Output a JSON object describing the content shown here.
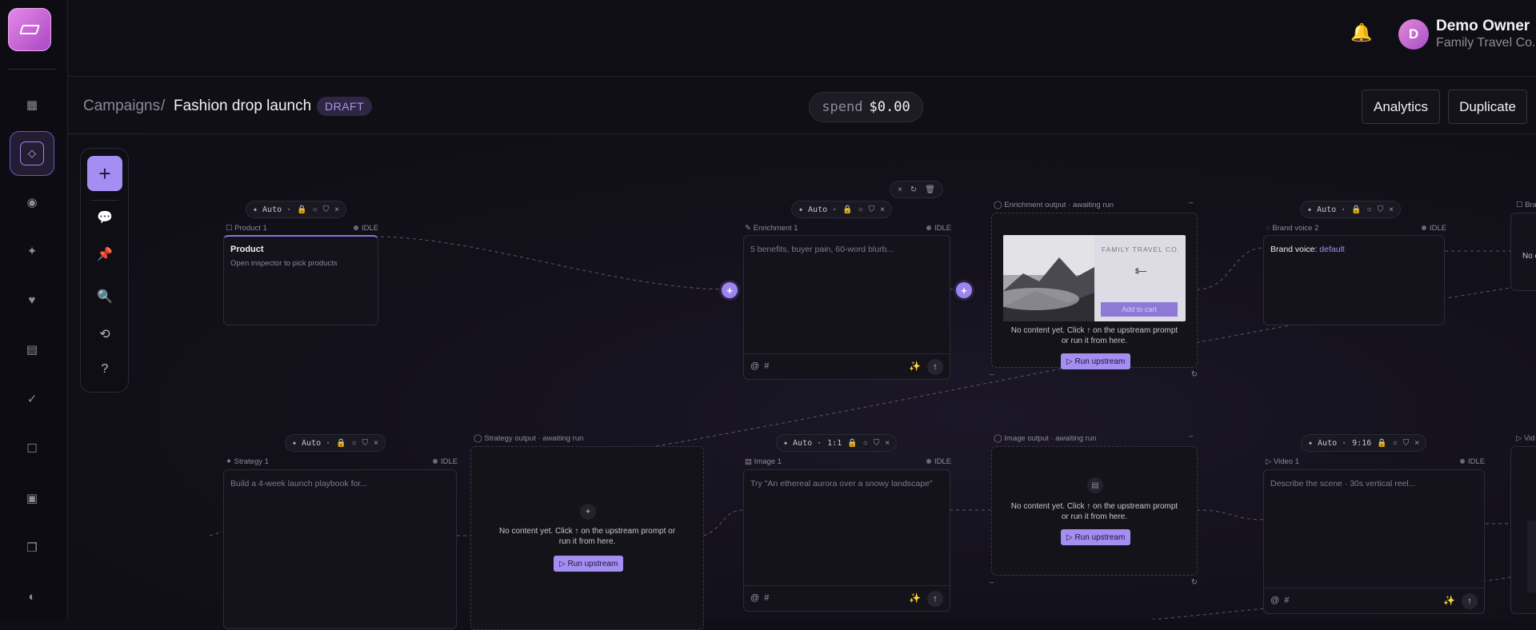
{
  "user": {
    "name": "Demo Owner",
    "org": "Family Travel Co.",
    "initial": "D"
  },
  "breadcrumb": {
    "parent": "Campaigns",
    "separator": "/",
    "current": "Fashion drop launch",
    "status": "DRAFT"
  },
  "spend": {
    "label": "spend",
    "value": "$0.00"
  },
  "actions": {
    "analytics": "Analytics",
    "duplicate": "Duplicate"
  },
  "icons": {
    "logo": "logo-icon",
    "bell": "notification-bell-icon",
    "rail": [
      "grid-icon",
      "diamond-icon",
      "circle-dot-icon",
      "sparkle-icon",
      "heart-icon",
      "list-icon",
      "check-icon",
      "square-icon",
      "frame-icon",
      "copy-icon",
      "contrast-icon"
    ],
    "toolbar": [
      "add-icon",
      "comment-icon",
      "pin-icon",
      "search-icon",
      "history-icon",
      "help-icon"
    ]
  },
  "pill_labels": {
    "auto": "✦ Auto ·",
    "close": "×",
    "ratio_square": "1:1",
    "ratio_vertical": "9:16"
  },
  "nodes": {
    "product": {
      "header": "Product 1",
      "status": "IDLE",
      "title": "Product",
      "subtitle": "Open inspector to pick products"
    },
    "enrichment": {
      "header": "Enrichment 1",
      "status": "IDLE",
      "placeholder": "5 benefits, buyer pain, 60-word blurb..."
    },
    "enrichment_output": {
      "header": "Enrichment output · awaiting run",
      "message": "No content yet. Click ↑ on the upstream prompt or run it from here.",
      "button": "▷ Run upstream",
      "preview_brand": "FAMILY TRAVEL CO.",
      "preview_price": "$—",
      "preview_cta": "Add to cart"
    },
    "brand_voice": {
      "header": "Brand voice 2",
      "status": "IDLE",
      "label": "Brand voice:",
      "value": "default"
    },
    "strategy": {
      "header": "Strategy 1",
      "status": "IDLE",
      "placeholder": "Build a 4-week launch playbook for..."
    },
    "strategy_output": {
      "header": "Strategy output · awaiting run",
      "message": "No content yet. Click ↑ on the upstream prompt or run it from here.",
      "button": "▷ Run upstream"
    },
    "image": {
      "header": "Image 1",
      "status": "IDLE",
      "placeholder": "Try \"An ethereal aurora over a snowy landscape\""
    },
    "image_output": {
      "header": "Image output · awaiting run",
      "message": "No content yet. Click ↑ on the upstream prompt or run it from here.",
      "button": "▷ Run upstream"
    },
    "video": {
      "header": "Video 1",
      "status": "IDLE",
      "placeholder": "Describe the scene · 30s vertical reel..."
    },
    "edge_right_top": {
      "header": "Bra",
      "text": "No c"
    },
    "edge_right_bottom": {
      "header": "Vid"
    }
  },
  "prompt_footer": {
    "mention": "@",
    "hash": "#",
    "magic": "✨",
    "send": "↑"
  }
}
